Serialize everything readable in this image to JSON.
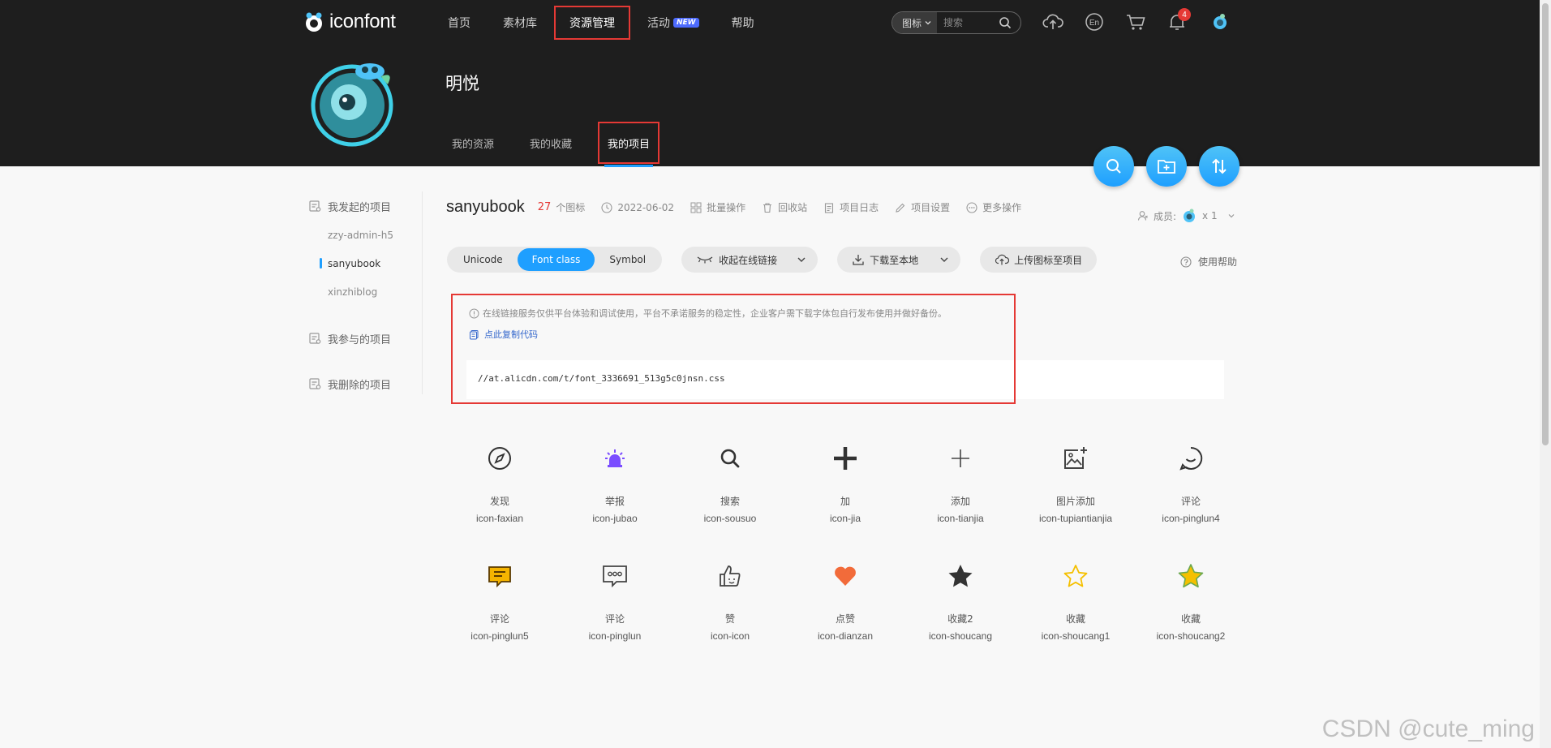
{
  "header": {
    "logo_text": "iconfont",
    "nav": [
      {
        "label": "首页"
      },
      {
        "label": "素材库"
      },
      {
        "label": "资源管理"
      },
      {
        "label": "活动",
        "badge": "NEW"
      },
      {
        "label": "帮助"
      }
    ],
    "search": {
      "type_label": "图标",
      "placeholder": "搜索"
    },
    "notification_count": "4"
  },
  "profile": {
    "name": "明悦",
    "tabs": [
      {
        "label": "我的资源"
      },
      {
        "label": "我的收藏"
      },
      {
        "label": "我的项目"
      }
    ]
  },
  "sidebar": {
    "groups": [
      {
        "label": "我发起的项目",
        "items": [
          "zzy-admin-h5",
          "sanyubook",
          "xinzhiblog"
        ]
      },
      {
        "label": "我参与的项目"
      },
      {
        "label": "我删除的项目"
      }
    ]
  },
  "project": {
    "name": "sanyubook",
    "count": "27",
    "count_unit": "个图标",
    "date": "2022-06-02",
    "actions": [
      "批量操作",
      "回收站",
      "项目日志",
      "项目设置",
      "更多操作"
    ],
    "members_label": "成员:",
    "members_count": "x 1"
  },
  "toolbar": {
    "segments": [
      "Unicode",
      "Font class",
      "Symbol"
    ],
    "active_segment": "Font class",
    "collapse_link": "收起在线链接",
    "download": "下载至本地",
    "upload": "上传图标至项目",
    "help": "使用帮助"
  },
  "code_panel": {
    "notice": "在线链接服务仅供平台体验和调试使用，平台不承诺服务的稳定性，企业客户需下载字体包自行发布使用并做好备份。",
    "copy_label": "点此复制代码",
    "code": "//at.alicdn.com/t/font_3336691_513g5c0jnsn.css"
  },
  "icons": [
    {
      "cn": "发现",
      "en": "icon-faxian",
      "glyph": "compass-icon"
    },
    {
      "cn": "举报",
      "en": "icon-jubao",
      "glyph": "alarm-icon",
      "color": "#7b4dff"
    },
    {
      "cn": "搜索",
      "en": "icon-sousuo",
      "glyph": "search-icon"
    },
    {
      "cn": "加",
      "en": "icon-jia",
      "glyph": "plus-bold-icon"
    },
    {
      "cn": "添加",
      "en": "icon-tianjia",
      "glyph": "plus-thin-icon"
    },
    {
      "cn": "图片添加",
      "en": "icon-tupiantianjia",
      "glyph": "image-add-icon"
    },
    {
      "cn": "评论",
      "en": "icon-pinglun4",
      "glyph": "chat-bubble-icon"
    },
    {
      "cn": "评论",
      "en": "icon-pinglun5",
      "glyph": "comment-yellow-icon",
      "color": "#f5b400"
    },
    {
      "cn": "评论",
      "en": "icon-pinglun",
      "glyph": "comment-dots-icon"
    },
    {
      "cn": "赞",
      "en": "icon-icon",
      "glyph": "thumbs-up-icon"
    },
    {
      "cn": "点赞",
      "en": "icon-dianzan",
      "glyph": "heart-icon",
      "color": "#f26b3a"
    },
    {
      "cn": "收藏2",
      "en": "icon-shoucang",
      "glyph": "star-filled-icon",
      "color": "#333333"
    },
    {
      "cn": "收藏",
      "en": "icon-shoucang1",
      "glyph": "star-outline-icon",
      "color": "#f5c000"
    },
    {
      "cn": "收藏",
      "en": "icon-shoucang2",
      "glyph": "star-green-icon",
      "color": "#f5c000"
    }
  ],
  "watermark": "CSDN @cute_ming",
  "colors": {
    "accent": "#1e9fff",
    "highlight": "#e53935",
    "header_bg": "#1e1e1e"
  }
}
